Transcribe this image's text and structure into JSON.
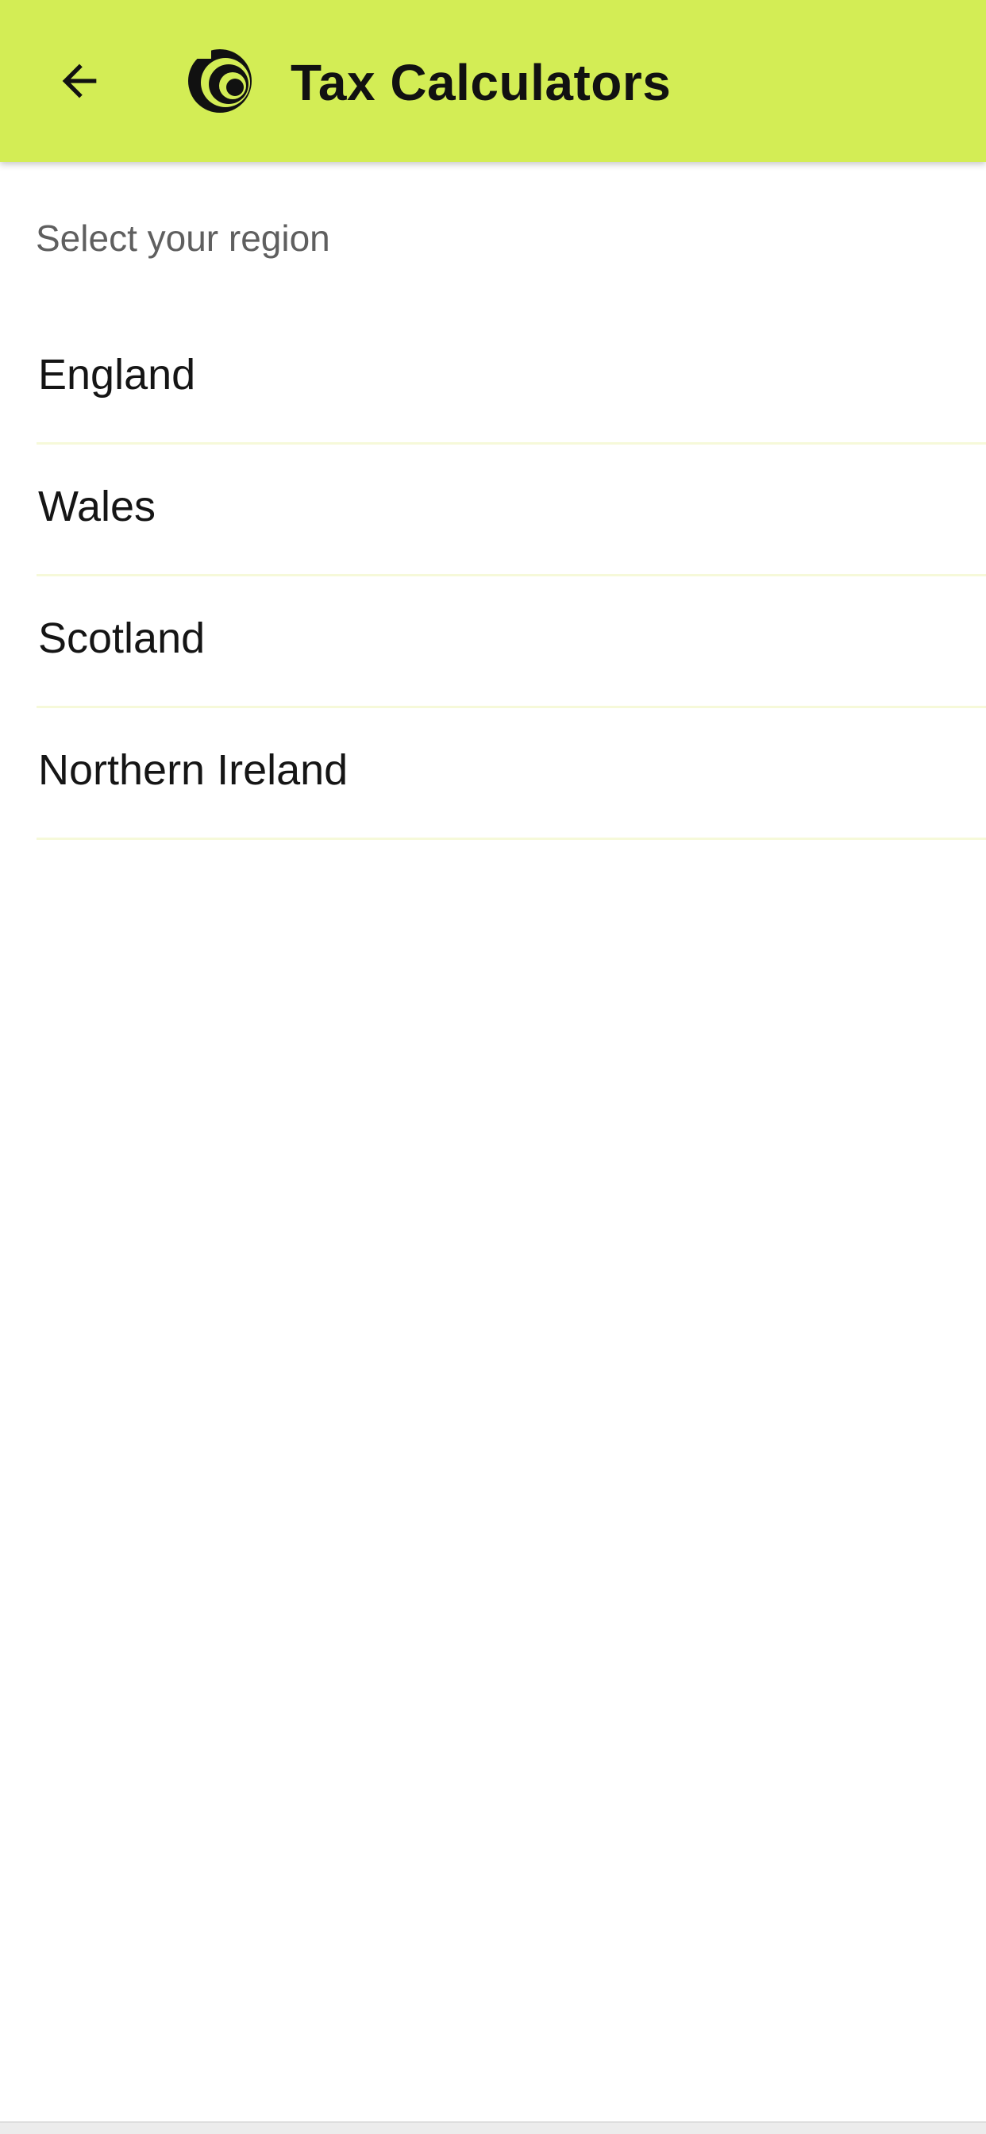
{
  "colors": {
    "appbar_background": "#d3ed55",
    "title_text": "#111111",
    "section_label_text": "#5f5f5f",
    "list_text": "#151515",
    "divider": "#f6f9d9"
  },
  "appbar": {
    "back_icon": "arrow-back-icon",
    "logo_icon": "spiral-logo-icon",
    "title": "Tax Calculators"
  },
  "main": {
    "section_label": "Select your region",
    "regions": [
      {
        "label": "England"
      },
      {
        "label": "Wales"
      },
      {
        "label": "Scotland"
      },
      {
        "label": "Northern Ireland"
      }
    ]
  }
}
